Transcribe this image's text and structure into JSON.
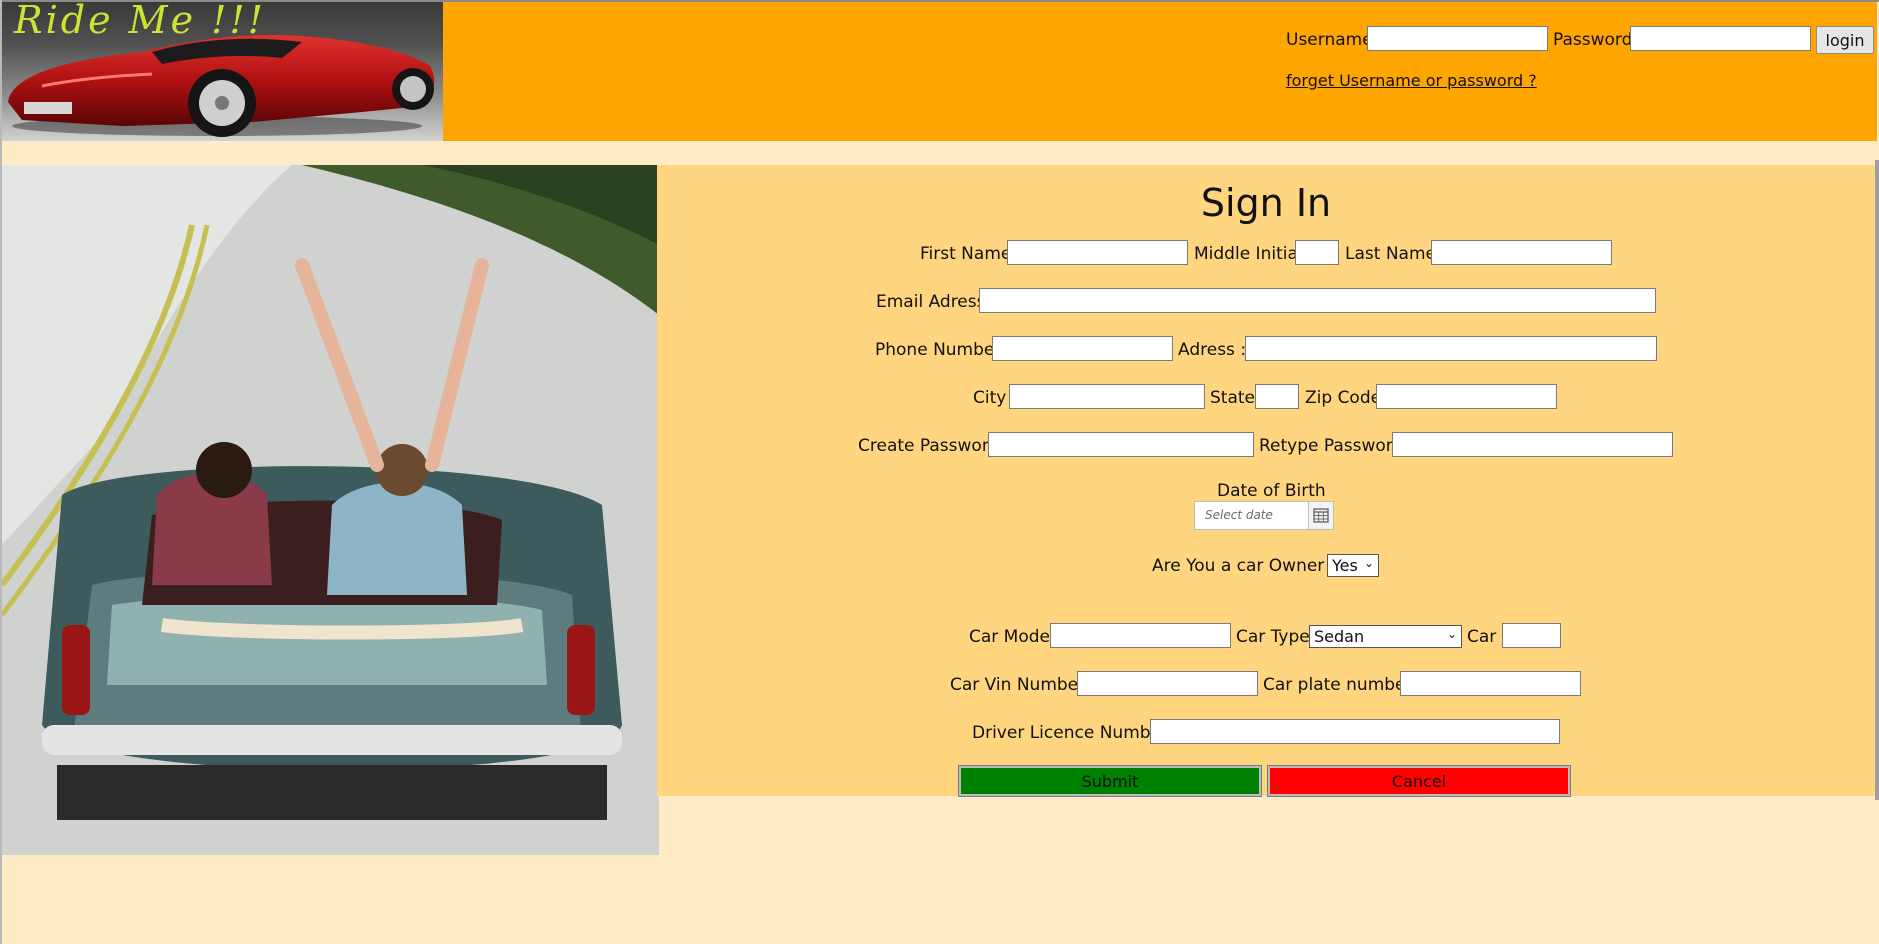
{
  "header": {
    "logo_text": "Ride Me !!!",
    "username_label": "Username",
    "username_value": "",
    "password_label": "Password",
    "password_value": "",
    "login_label": "login",
    "forget_link": "forget Username or password ?"
  },
  "form": {
    "title": "Sign In",
    "first_name_label": "First Name",
    "middle_initial_label": "Middle Initial",
    "last_name_label": "Last Name",
    "email_label": "Email Adress",
    "phone_label": "Phone Number",
    "address_label": "Adress :",
    "city_label": "City",
    "state_label": "State",
    "zip_label": "Zip Code",
    "create_password_label": "Create Password",
    "retype_password_label": "Retype Password",
    "dob_label": "Date of Birth",
    "dob_placeholder": "Select date",
    "car_owner_label": "Are You a car Owner ?",
    "car_owner_value": "Yes",
    "car_model_label": "Car Model",
    "car_type_label": "Car Type",
    "car_type_value": "Sedan",
    "car_year_label": "Car Year",
    "car_vin_label": "Car Vin Number",
    "car_plate_label": "Car plate number",
    "licence_label": "Driver Licence Number",
    "submit_label": "Submit",
    "cancel_label": "Cancel"
  },
  "colors": {
    "header_bg": "#FFA500",
    "page_bg": "#FFEBC6",
    "panel_bg": "#FFD580",
    "submit_bg": "#008000",
    "cancel_bg": "#FF0000"
  },
  "icons": {
    "calendar": "calendar-icon",
    "dropdown": "chevron-down-icon"
  }
}
